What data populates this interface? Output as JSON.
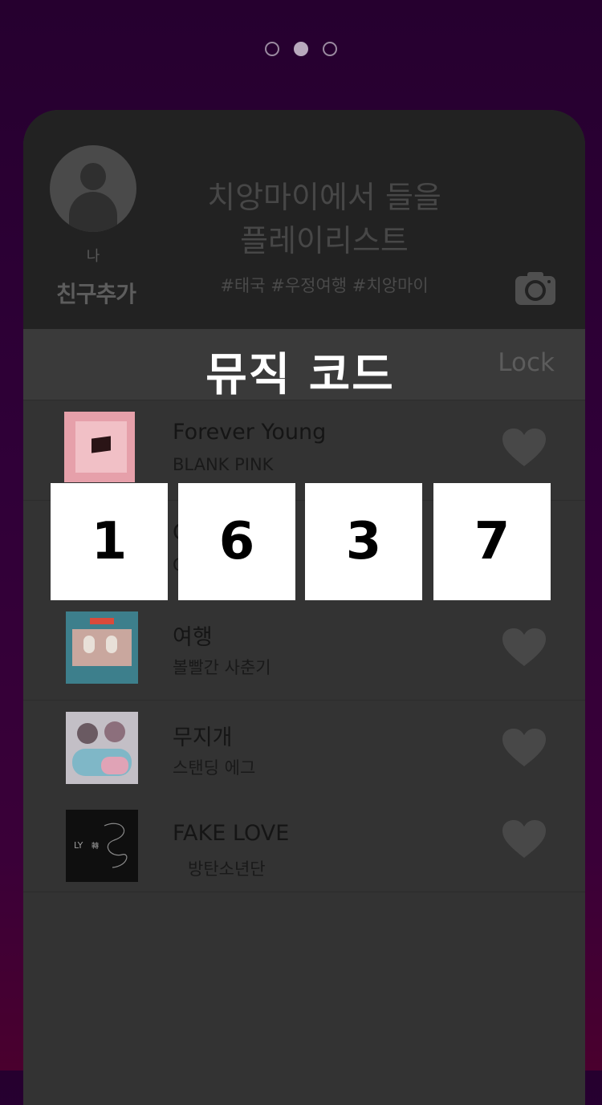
{
  "pager": {
    "count": 3,
    "active": 1
  },
  "profile": {
    "me_label": "나",
    "add_friend_label": "친구추가"
  },
  "playlist": {
    "title_line1": "치앙마이에서 들을",
    "title_line2": "플레이리스트",
    "tags": "#태국 #우정여행 #치앙마이"
  },
  "code_bar": {
    "title": "뮤직 코드",
    "lock_label": "Lock"
  },
  "songs": [
    {
      "title": "Forever Young",
      "artist": "BLANK PINK",
      "cover_color": "#e9a3ad"
    },
    {
      "title": "C",
      "artist": "C",
      "cover_color": "#555555"
    },
    {
      "title": "여행",
      "artist": "볼빨간 사춘기",
      "cover_color": "#3d7f8c"
    },
    {
      "title": "무지개",
      "artist": "스탠딩 에그",
      "cover_color": "#b9b4be"
    },
    {
      "title": "FAKE LOVE",
      "artist": "방탄소년단",
      "cover_color": "#111111"
    }
  ],
  "music_code": [
    "1",
    "6",
    "3",
    "7"
  ],
  "colors": {
    "background_top": "#26002f",
    "background_bottom": "#4a002e",
    "card": "#333333",
    "header": "#222222",
    "digit_box": "#ffffff"
  }
}
